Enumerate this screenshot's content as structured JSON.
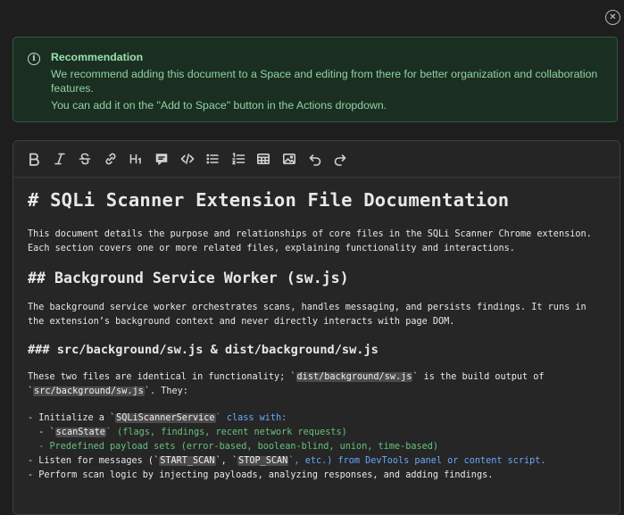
{
  "close_icon": "close-icon",
  "alert": {
    "icon": "info-icon",
    "title": "Recommendation",
    "line1": "We recommend adding this document to a Space and editing from there for better organization and collaboration features.",
    "line2": "You can add it on the \"Add to Space\" button in the Actions dropdown."
  },
  "toolbar": {
    "bold": "B",
    "italic": "I",
    "heading": "H₁",
    "buttons": [
      "bold-icon",
      "italic-icon",
      "strikethrough-icon",
      "link-icon",
      "heading-icon",
      "comment-icon",
      "code-icon",
      "bullet-list-icon",
      "numbered-list-icon",
      "table-icon",
      "image-icon",
      "undo-icon",
      "redo-icon"
    ]
  },
  "doc": {
    "h1": "# SQLi Scanner Extension File Documentation",
    "intro1": "This document details the purpose and relationships of core files in the SQLi Scanner Chrome extension.",
    "intro2": "Each section covers one or more related files, explaining functionality and interactions.",
    "h2": "## Background Service Worker (sw.js)",
    "bg1": "The background service worker orchestrates scans, handles messaging, and persists findings. It runs in",
    "bg2": "the extension’s background context and never directly interacts with page DOM.",
    "h3": "### src/background/sw.js & dist/background/sw.js",
    "p3a": "These two files are identical in functionality; `",
    "p3code1": "dist/background/sw.js",
    "p3b": "` is the build output of",
    "p3c": "`",
    "p3code2": "src/background/sw.js",
    "p3d": "`. They:",
    "l1a": "- Initialize a `",
    "l1code": "SQLiScannerService",
    "l1b": "` class with:",
    "l2a": "  - `",
    "l2code": "scanState",
    "l2b": "` (flags, findings, recent network requests)",
    "l3": "  - Predefined payload sets (error-based, boolean-blind, union, time-based)",
    "l4a": "- Listen for messages (`",
    "l4code1": "START_SCAN",
    "l4b": "`, `",
    "l4code2": "STOP_SCAN",
    "l4c": "`, etc.) from DevTools panel or content script.",
    "l5": "- Perform scan logic by injecting payloads, analyzing responses, and adding findings."
  }
}
